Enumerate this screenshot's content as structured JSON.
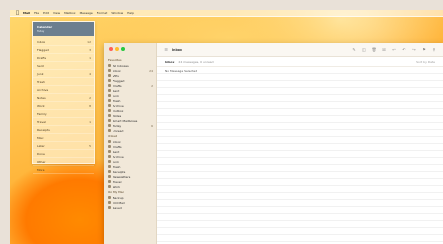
{
  "menubar": {
    "app": "Mail",
    "items": [
      "File",
      "Edit",
      "View",
      "Mailbox",
      "Message",
      "Format",
      "Window",
      "Help"
    ]
  },
  "left_panel": {
    "title": "Calendar",
    "subtitle": "Today",
    "rows": [
      {
        "label": "Inbox",
        "value": "12"
      },
      {
        "label": "Flagged",
        "value": "3"
      },
      {
        "label": "Drafts",
        "value": "1"
      },
      {
        "label": "Sent",
        "value": ""
      },
      {
        "label": "Junk",
        "value": "4"
      },
      {
        "label": "Trash",
        "value": ""
      },
      {
        "label": "Archive",
        "value": ""
      },
      {
        "label": "Notes",
        "value": "2"
      },
      {
        "label": "Work",
        "value": "8"
      },
      {
        "label": "Family",
        "value": ""
      },
      {
        "label": "Travel",
        "value": "1"
      },
      {
        "label": "Receipts",
        "value": ""
      },
      {
        "label": "Misc",
        "value": ""
      },
      {
        "label": "Later",
        "value": "5"
      },
      {
        "label": "Done",
        "value": ""
      },
      {
        "label": "Other",
        "value": ""
      },
      {
        "label": "More",
        "value": ""
      }
    ]
  },
  "sidebar": {
    "sections": [
      {
        "title": "Favorites",
        "items": [
          {
            "label": "All Inboxes",
            "count": ""
          },
          {
            "label": "Inbox",
            "count": "24"
          },
          {
            "label": "VIPs",
            "count": ""
          },
          {
            "label": "Flagged",
            "count": ""
          },
          {
            "label": "Drafts",
            "count": "2"
          },
          {
            "label": "Sent",
            "count": ""
          },
          {
            "label": "Junk",
            "count": ""
          },
          {
            "label": "Trash",
            "count": ""
          },
          {
            "label": "Archive",
            "count": ""
          },
          {
            "label": "Outbox",
            "count": ""
          },
          {
            "label": "Notes",
            "count": ""
          },
          {
            "label": "Smart Mailboxes",
            "count": ""
          },
          {
            "label": "Today",
            "count": "6"
          },
          {
            "label": "Unread",
            "count": ""
          }
        ]
      },
      {
        "title": "iCloud",
        "items": [
          {
            "label": "Inbox",
            "count": ""
          },
          {
            "label": "Drafts",
            "count": ""
          },
          {
            "label": "Sent",
            "count": ""
          },
          {
            "label": "Archive",
            "count": ""
          },
          {
            "label": "Junk",
            "count": ""
          },
          {
            "label": "Trash",
            "count": ""
          },
          {
            "label": "Receipts",
            "count": ""
          },
          {
            "label": "Newsletters",
            "count": ""
          },
          {
            "label": "Travel",
            "count": ""
          },
          {
            "label": "Work",
            "count": ""
          }
        ]
      },
      {
        "title": "On My Mac",
        "items": [
          {
            "label": "Backup",
            "count": ""
          },
          {
            "label": "Old Mail",
            "count": ""
          },
          {
            "label": "Saved",
            "count": ""
          }
        ]
      }
    ]
  },
  "toolbar": {
    "title": "Inbox",
    "buttons": [
      "compose-icon",
      "archive-icon",
      "trash-icon",
      "junk-icon",
      "reply-icon",
      "reply-all-icon",
      "forward-icon",
      "flag-icon",
      "search-icon"
    ]
  },
  "subbar": {
    "crumb": "Inbox",
    "crumb_sub": "24 messages, 0 unread",
    "right": "Sort by Date"
  },
  "content": {
    "first_row": "No Message Selected"
  },
  "colors": {
    "panel_header": "#6c7f8f",
    "sidebar_bg": "#f1e8d9",
    "wallpaper_primary": "#ff9b1d"
  }
}
